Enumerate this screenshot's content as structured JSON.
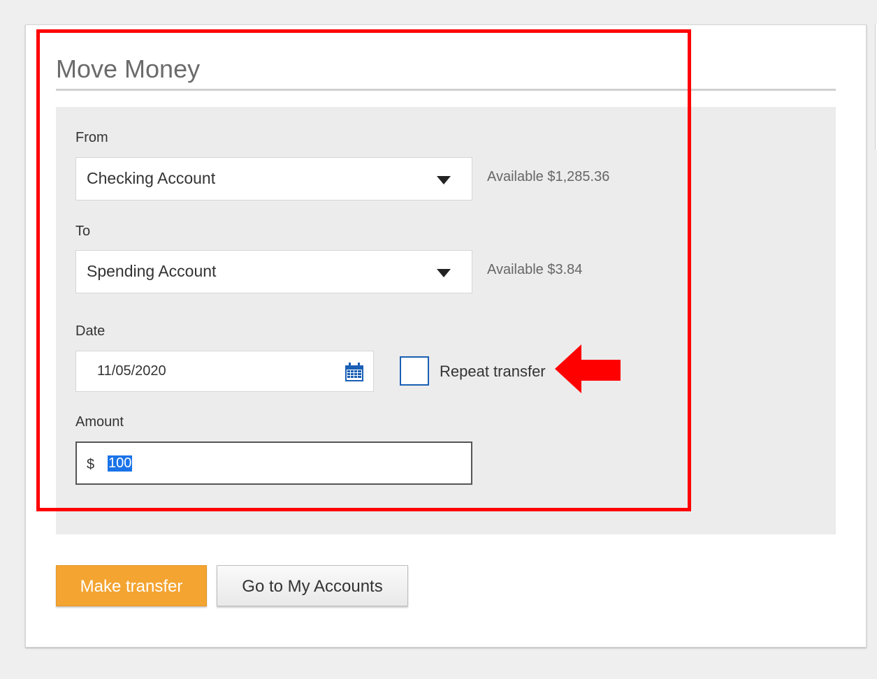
{
  "page": {
    "title": "Move Money"
  },
  "from": {
    "label": "From",
    "selected": "Checking Account",
    "available": "Available $1,285.36"
  },
  "to": {
    "label": "To",
    "selected": "Spending Account",
    "available": "Available $3.84"
  },
  "date": {
    "label": "Date",
    "value": "11/05/2020"
  },
  "repeat": {
    "label": "Repeat transfer",
    "checked": false
  },
  "amount": {
    "label": "Amount",
    "currency": "$",
    "value": "100"
  },
  "actions": {
    "primary_label": "Make transfer",
    "secondary_label": "Go to My Accounts"
  },
  "colors": {
    "primary_button": "#f4a431",
    "highlight_border": "#ff0000",
    "checkbox_border": "#1a5fb4",
    "calendar_icon": "#1a5fb4"
  },
  "icons": {
    "from_dropdown": "chevron-down-icon",
    "to_dropdown": "chevron-down-icon",
    "date_picker": "calendar-icon",
    "annotation": "arrow-left-icon"
  }
}
